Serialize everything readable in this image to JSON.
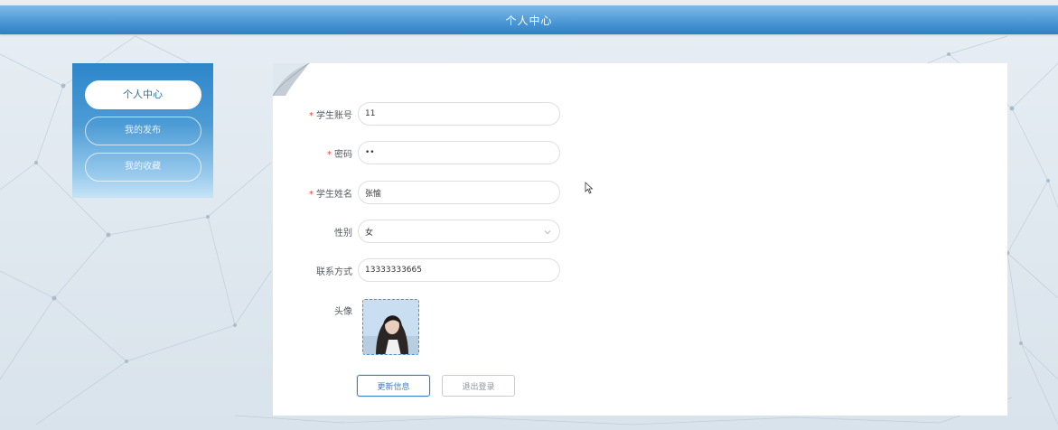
{
  "header": {
    "title": "个人中心"
  },
  "sidebar": {
    "items": [
      {
        "label": "个人中心",
        "active": true
      },
      {
        "label": "我的发布",
        "active": false
      },
      {
        "label": "我的收藏",
        "active": false
      }
    ]
  },
  "form": {
    "account": {
      "label": "学生账号",
      "value": "11",
      "required": true
    },
    "password": {
      "label": "密码",
      "value": "••",
      "required": true
    },
    "name": {
      "label": "学生姓名",
      "value": "张愉",
      "required": true
    },
    "gender": {
      "label": "性别",
      "value": "女"
    },
    "contact": {
      "label": "联系方式",
      "value": "13333333665"
    },
    "avatar": {
      "label": "头像"
    }
  },
  "actions": {
    "update_label": "更新信息",
    "logout_label": "退出登录"
  },
  "colors": {
    "header_blue": "#3f8ccf",
    "required_red": "#e0443c",
    "primary_blue": "#3a7fc6"
  }
}
